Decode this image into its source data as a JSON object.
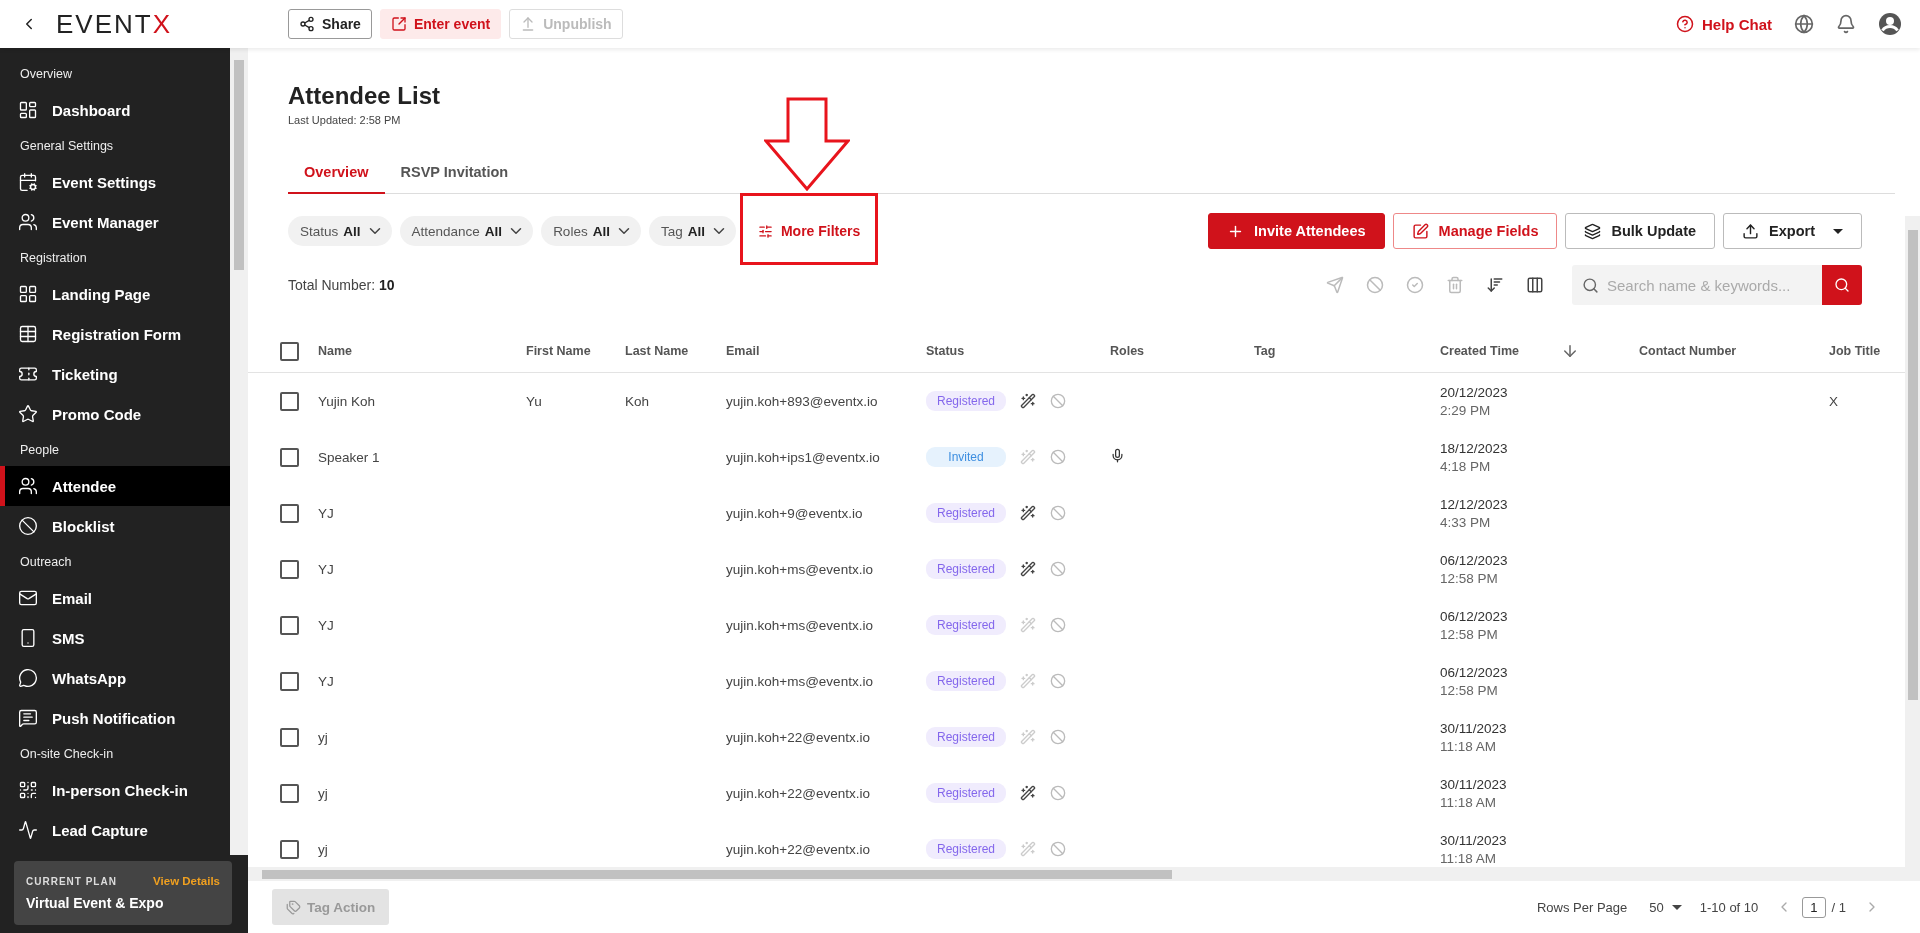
{
  "top_bar": {
    "logo": {
      "text": "EVENT",
      "accent": "X"
    },
    "buttons": [
      {
        "label": "Share",
        "kind": "outline"
      },
      {
        "label": "Enter event",
        "kind": "soft"
      },
      {
        "label": "Unpublish",
        "kind": "disabled"
      }
    ],
    "help": "Help Chat"
  },
  "sidebar": {
    "sections": [
      {
        "title": "Overview",
        "items": [
          {
            "label": "Dashboard",
            "selected": false
          }
        ]
      },
      {
        "title": "General Settings",
        "items": [
          {
            "label": "Event Settings",
            "selected": false
          },
          {
            "label": "Event Manager",
            "selected": false
          }
        ]
      },
      {
        "title": "Registration",
        "items": [
          {
            "label": "Landing Page",
            "selected": false
          },
          {
            "label": "Registration Form",
            "selected": false
          },
          {
            "label": "Ticketing",
            "selected": false
          },
          {
            "label": "Promo Code",
            "selected": false
          }
        ]
      },
      {
        "title": "People",
        "items": [
          {
            "label": "Attendee",
            "selected": true
          },
          {
            "label": "Blocklist",
            "selected": false
          }
        ]
      },
      {
        "title": "Outreach",
        "items": [
          {
            "label": "Email",
            "selected": false
          },
          {
            "label": "SMS",
            "selected": false
          },
          {
            "label": "WhatsApp",
            "selected": false
          },
          {
            "label": "Push Notification",
            "selected": false
          }
        ]
      },
      {
        "title": "On-site Check-in",
        "items": [
          {
            "label": "In-person Check-in",
            "selected": false
          },
          {
            "label": "Lead Capture",
            "selected": false
          }
        ]
      }
    ],
    "plan": {
      "caption": "CURRENT PLAN",
      "link": "View Details",
      "name": "Virtual Event & Expo"
    }
  },
  "page": {
    "title": "Attendee List",
    "updated": "Last Updated: 2:58 PM"
  },
  "tabs": [
    {
      "label": "Overview",
      "selected": true
    },
    {
      "label": "RSVP Invitation",
      "selected": false
    }
  ],
  "filters": [
    {
      "label": "Status",
      "value": "All"
    },
    {
      "label": "Attendance",
      "value": "All"
    },
    {
      "label": "Roles",
      "value": "All"
    },
    {
      "label": "Tag",
      "value": "All"
    }
  ],
  "more_filters": "More Filters",
  "annotation": {
    "kind": "arrow_and_box"
  },
  "actions": [
    {
      "label": "Invite Attendees",
      "kind": "primary"
    },
    {
      "label": "Manage Fields",
      "kind": "outline_red"
    },
    {
      "label": "Bulk Update",
      "kind": "outline"
    },
    {
      "label": "Export",
      "kind": "dropdown"
    }
  ],
  "total": {
    "label": "Total Number:",
    "value": "10"
  },
  "search": {
    "placeholder": "Search name & keywords..."
  },
  "table": {
    "select_all_checked": false,
    "columns": [
      "Name",
      "First Name",
      "Last Name",
      "Email",
      "Status",
      "Roles",
      "Tag",
      "Created Time",
      "Contact Number",
      "Job Title"
    ],
    "rows": [
      {
        "checked": false,
        "name": "Yujin Koh",
        "first_name": "Yu",
        "last_name": "Koh",
        "email": "yujin.koh+893@eventx.io",
        "status": {
          "label": "Registered",
          "kind": "registered"
        },
        "wand_active": true,
        "role_icon": false,
        "date": "20/12/2023",
        "time": "2:29 PM",
        "job_title": "X"
      },
      {
        "checked": false,
        "name": "Speaker 1",
        "email": "yujin.koh+ips1@eventx.io",
        "status": {
          "label": "Invited",
          "kind": "invited"
        },
        "wand_active": false,
        "role_icon": true,
        "date": "18/12/2023",
        "time": "4:18 PM"
      },
      {
        "checked": false,
        "name": "YJ",
        "email": "yujin.koh+9@eventx.io",
        "status": {
          "label": "Registered",
          "kind": "registered"
        },
        "wand_active": true,
        "role_icon": false,
        "date": "12/12/2023",
        "time": "4:33 PM"
      },
      {
        "checked": false,
        "name": "YJ",
        "email": "yujin.koh+ms@eventx.io",
        "status": {
          "label": "Registered",
          "kind": "registered"
        },
        "wand_active": true,
        "role_icon": false,
        "date": "06/12/2023",
        "time": "12:58 PM"
      },
      {
        "checked": false,
        "name": "YJ",
        "email": "yujin.koh+ms@eventx.io",
        "status": {
          "label": "Registered",
          "kind": "registered"
        },
        "wand_active": false,
        "role_icon": false,
        "date": "06/12/2023",
        "time": "12:58 PM"
      },
      {
        "checked": false,
        "name": "YJ",
        "email": "yujin.koh+ms@eventx.io",
        "status": {
          "label": "Registered",
          "kind": "registered"
        },
        "wand_active": false,
        "role_icon": false,
        "date": "06/12/2023",
        "time": "12:58 PM"
      },
      {
        "checked": false,
        "name": "yj",
        "email": "yujin.koh+22@eventx.io",
        "status": {
          "label": "Registered",
          "kind": "registered"
        },
        "wand_active": false,
        "role_icon": false,
        "date": "30/11/2023",
        "time": "11:18 AM"
      },
      {
        "checked": false,
        "name": "yj",
        "email": "yujin.koh+22@eventx.io",
        "status": {
          "label": "Registered",
          "kind": "registered"
        },
        "wand_active": true,
        "role_icon": false,
        "date": "30/11/2023",
        "time": "11:18 AM"
      },
      {
        "checked": false,
        "name": "yj",
        "email": "yujin.koh+22@eventx.io",
        "status": {
          "label": "Registered",
          "kind": "registered"
        },
        "wand_active": false,
        "role_icon": false,
        "date": "30/11/2023",
        "time": "11:18 AM"
      }
    ]
  },
  "footer": {
    "tag_action": "Tag Action",
    "rows_label": "Rows Per Page",
    "rows_value": "50",
    "range": "1-10 of 10",
    "page": "1",
    "pages": "/ 1"
  }
}
